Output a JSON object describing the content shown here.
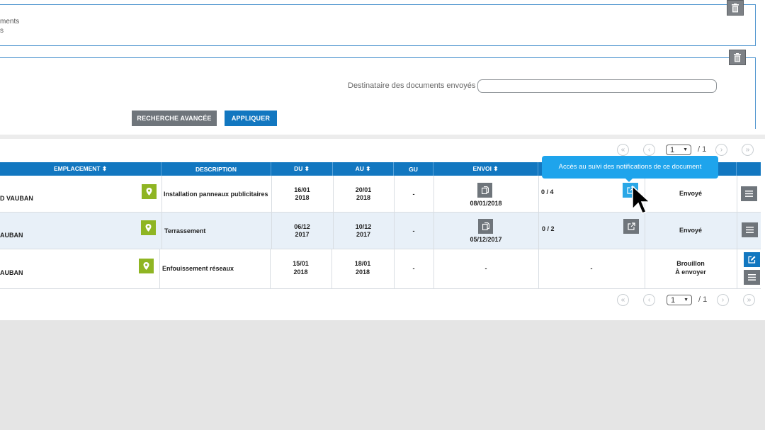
{
  "filters": {
    "panel1_line1": "ments",
    "panel1_line2": "s",
    "recipient_label": "Destinataire des documents envoyés",
    "recipient_value": "",
    "advanced_search": "RECHERCHE AVANCÉE",
    "apply": "APPLIQUER"
  },
  "pagination": {
    "current": "1",
    "total": "/ 1",
    "first": "«",
    "prev": "‹",
    "next": "›",
    "last": "»"
  },
  "table": {
    "headers": {
      "emplacement": "EMPLACEMENT ⬍",
      "description": "DESCRIPTION",
      "du": "DU ⬍",
      "au": "AU ⬍",
      "gu": "GU",
      "envoi": "ENVOI ⬍"
    },
    "rows": [
      {
        "emplacement": "D VAUBAN",
        "description": "Installation panneaux publicitaires",
        "du": "16/01\n2018",
        "du_line1": "16/01",
        "du_line2": "2018",
        "au_line1": "20/01",
        "au_line2": "2018",
        "gu": "-",
        "envoi": "08/01/2018",
        "count": "0 / 4",
        "status": "Envoyé"
      },
      {
        "emplacement": "AUBAN",
        "description": "Terrassement",
        "du_line1": "06/12",
        "du_line2": "2017",
        "au_line1": "10/12",
        "au_line2": "2017",
        "gu": "-",
        "envoi": "05/12/2017",
        "count": "0 / 2",
        "status": "Envoyé"
      },
      {
        "emplacement": "AUBAN",
        "description": "Enfouissement réseaux",
        "du_line1": "15/01",
        "du_line2": "2018",
        "au_line1": "18/01",
        "au_line2": "2018",
        "gu": "-",
        "envoi": "-",
        "count": "-",
        "status_line1": "Brouillon",
        "status_line2": "À envoyer"
      }
    ]
  },
  "tooltip": {
    "text": "Accès au suivi des notifications de ce document"
  },
  "colors": {
    "primary": "#1277c0",
    "tooltip": "#1ea4ec",
    "pin": "#8fb523",
    "grey_button": "#6f757b"
  }
}
